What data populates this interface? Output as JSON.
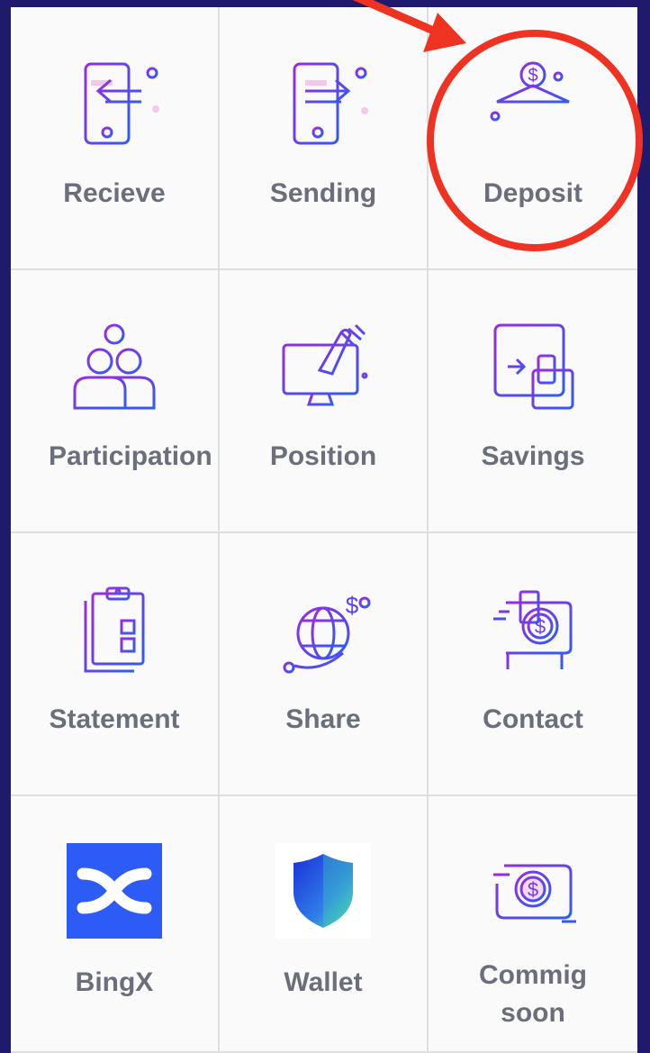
{
  "colors": {
    "frame": "#1f1a6b",
    "tile_bg": "#fafafa",
    "label": "#6b6f7b",
    "icon_gradient_start": "#8b2be2",
    "icon_gradient_end": "#2e5cf6",
    "annotation": "#ee3322",
    "bingx_blue": "#2c5bf5"
  },
  "grid": {
    "items": [
      {
        "label": "Recieve",
        "icon": "receive-icon"
      },
      {
        "label": "Sending",
        "icon": "sending-icon"
      },
      {
        "label": "Deposit",
        "icon": "bank-deposit-icon"
      },
      {
        "label": "Participation",
        "icon": "participation-icon"
      },
      {
        "label": "Position",
        "icon": "position-icon"
      },
      {
        "label": "Savings",
        "icon": "savings-icon"
      },
      {
        "label": "Statement",
        "icon": "statement-icon"
      },
      {
        "label": "Share",
        "icon": "share-icon"
      },
      {
        "label": "Contact",
        "icon": "contact-icon"
      },
      {
        "label": "BingX",
        "icon": "bingx-logo"
      },
      {
        "label": "Wallet",
        "icon": "wallet-shield-logo"
      },
      {
        "label": "Commig soon",
        "icon": "coming-soon-icon"
      }
    ]
  },
  "annotation": {
    "target": "Deposit",
    "shape": "circle-with-arrow"
  }
}
